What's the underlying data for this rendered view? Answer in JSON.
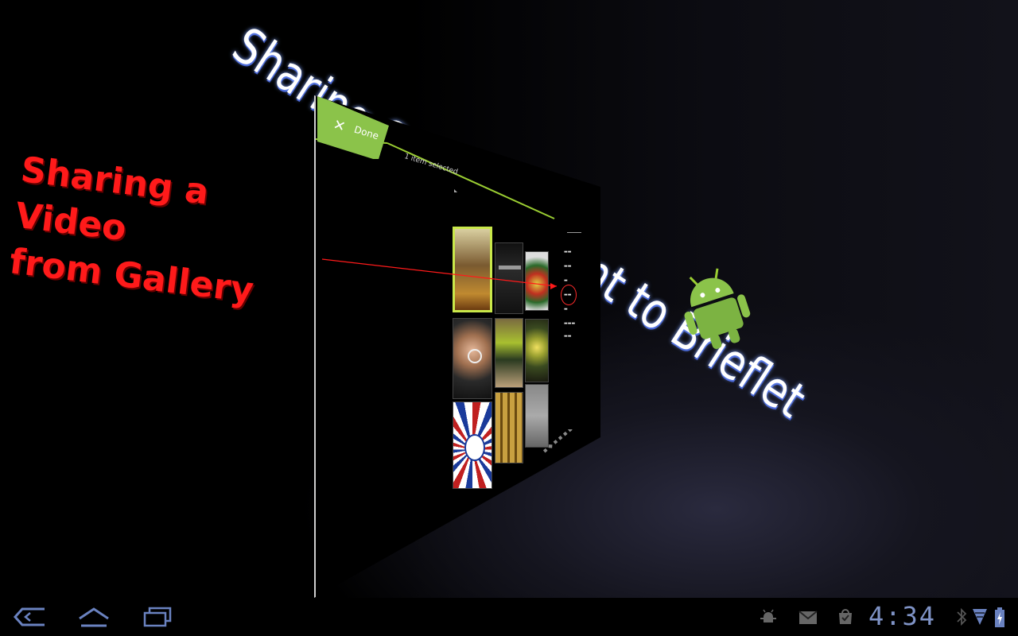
{
  "overlay": {
    "headline": "Sharing a Video\nfrom Gallery",
    "card_title": "Sharing Some Content to Brieflet"
  },
  "action_bar": {
    "done_label": "Done",
    "selection_status": "1 item selected"
  },
  "gallery": {
    "thumbnails": [
      {
        "name": "thumb-1",
        "selected": true
      },
      {
        "name": "thumb-2",
        "selected": false
      },
      {
        "name": "thumb-3",
        "selected": false
      },
      {
        "name": "thumb-4",
        "selected": false
      },
      {
        "name": "thumb-5",
        "selected": false
      },
      {
        "name": "thumb-6",
        "selected": false
      },
      {
        "name": "thumb-7",
        "selected": false
      },
      {
        "name": "thumb-8",
        "selected": false
      },
      {
        "name": "thumb-9",
        "selected": false
      }
    ]
  },
  "status_bar": {
    "time": "4:34",
    "icons": [
      "debug-icon",
      "gmail-icon",
      "market-download-icon",
      "bluetooth-icon",
      "wifi-icon",
      "battery-charging-icon"
    ]
  },
  "nav": {
    "icons": [
      "back-icon",
      "home-icon",
      "recent-apps-icon"
    ]
  },
  "colors": {
    "accent_green": "#8bc34a",
    "annotation_red": "#ff1a1a",
    "clock_blue": "#7f93c6"
  }
}
